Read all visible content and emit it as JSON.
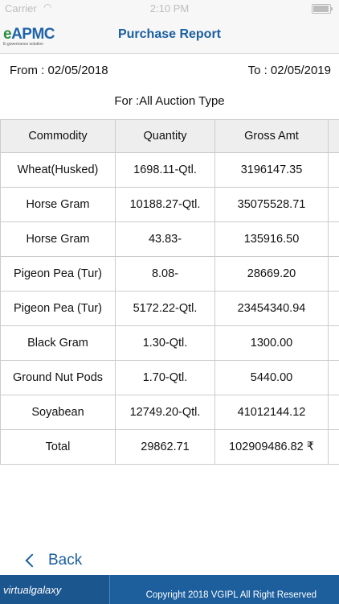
{
  "status_bar": {
    "carrier": "Carrier",
    "time": "2:10 PM"
  },
  "header": {
    "logo_text": "APMC",
    "logo_subtext": "E-governance solution",
    "title": "Purchase Report"
  },
  "filters": {
    "from_label": "From : 02/05/2018",
    "to_label": "To : 02/05/2019",
    "auction_type_label": "For :All Auction Type"
  },
  "table": {
    "headers": [
      "Commodity",
      "Quantity",
      "Gross Amt"
    ],
    "rows": [
      [
        "Wheat(Husked)",
        "1698.11-Qtl.",
        "3196147.35"
      ],
      [
        "Horse Gram",
        "10188.27-Qtl.",
        "35075528.71"
      ],
      [
        "Horse Gram",
        "43.83-",
        "135916.50"
      ],
      [
        "Pigeon Pea (Tur)",
        "8.08-",
        "28669.20"
      ],
      [
        "Pigeon Pea (Tur)",
        "5172.22-Qtl.",
        "23454340.94"
      ],
      [
        "Black Gram",
        "1.30-Qtl.",
        "1300.00"
      ],
      [
        "Ground Nut Pods",
        "1.70-Qtl.",
        "5440.00"
      ],
      [
        "Soyabean",
        "12749.20-Qtl.",
        "41012144.12"
      ]
    ],
    "total": [
      "Total",
      "29862.71",
      "102909486.82 ₹"
    ]
  },
  "back_label": "Back",
  "footer": {
    "brand": "virtualgalaxy",
    "copyright": "Copyright 2018 VGIPL All Right Reserved"
  }
}
